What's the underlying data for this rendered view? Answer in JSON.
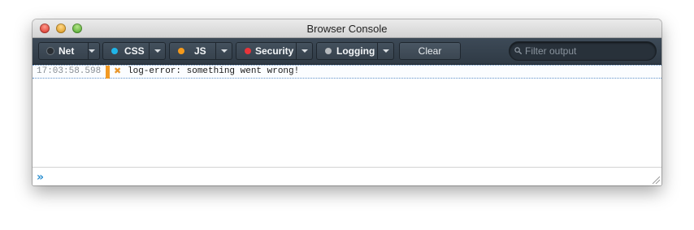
{
  "window": {
    "title": "Browser Console"
  },
  "toolbar": {
    "filters": [
      {
        "label": "Net",
        "dot_color": "#2a2f34"
      },
      {
        "label": "CSS",
        "dot_color": "#1fb4e8"
      },
      {
        "label": "JS",
        "dot_color": "#f59a1b"
      },
      {
        "label": "Security",
        "dot_color": "#e8343a"
      },
      {
        "label": "Logging",
        "dot_color": "#b6babe"
      }
    ],
    "clear_label": "Clear",
    "filter_placeholder": "Filter output"
  },
  "log": {
    "entries": [
      {
        "timestamp": "17:03:58.598",
        "severity": "error",
        "severity_color": "#f29a23",
        "icon": "error-x-icon",
        "message": "log-error: something went wrong!"
      }
    ]
  },
  "input": {
    "prompt": "»"
  }
}
